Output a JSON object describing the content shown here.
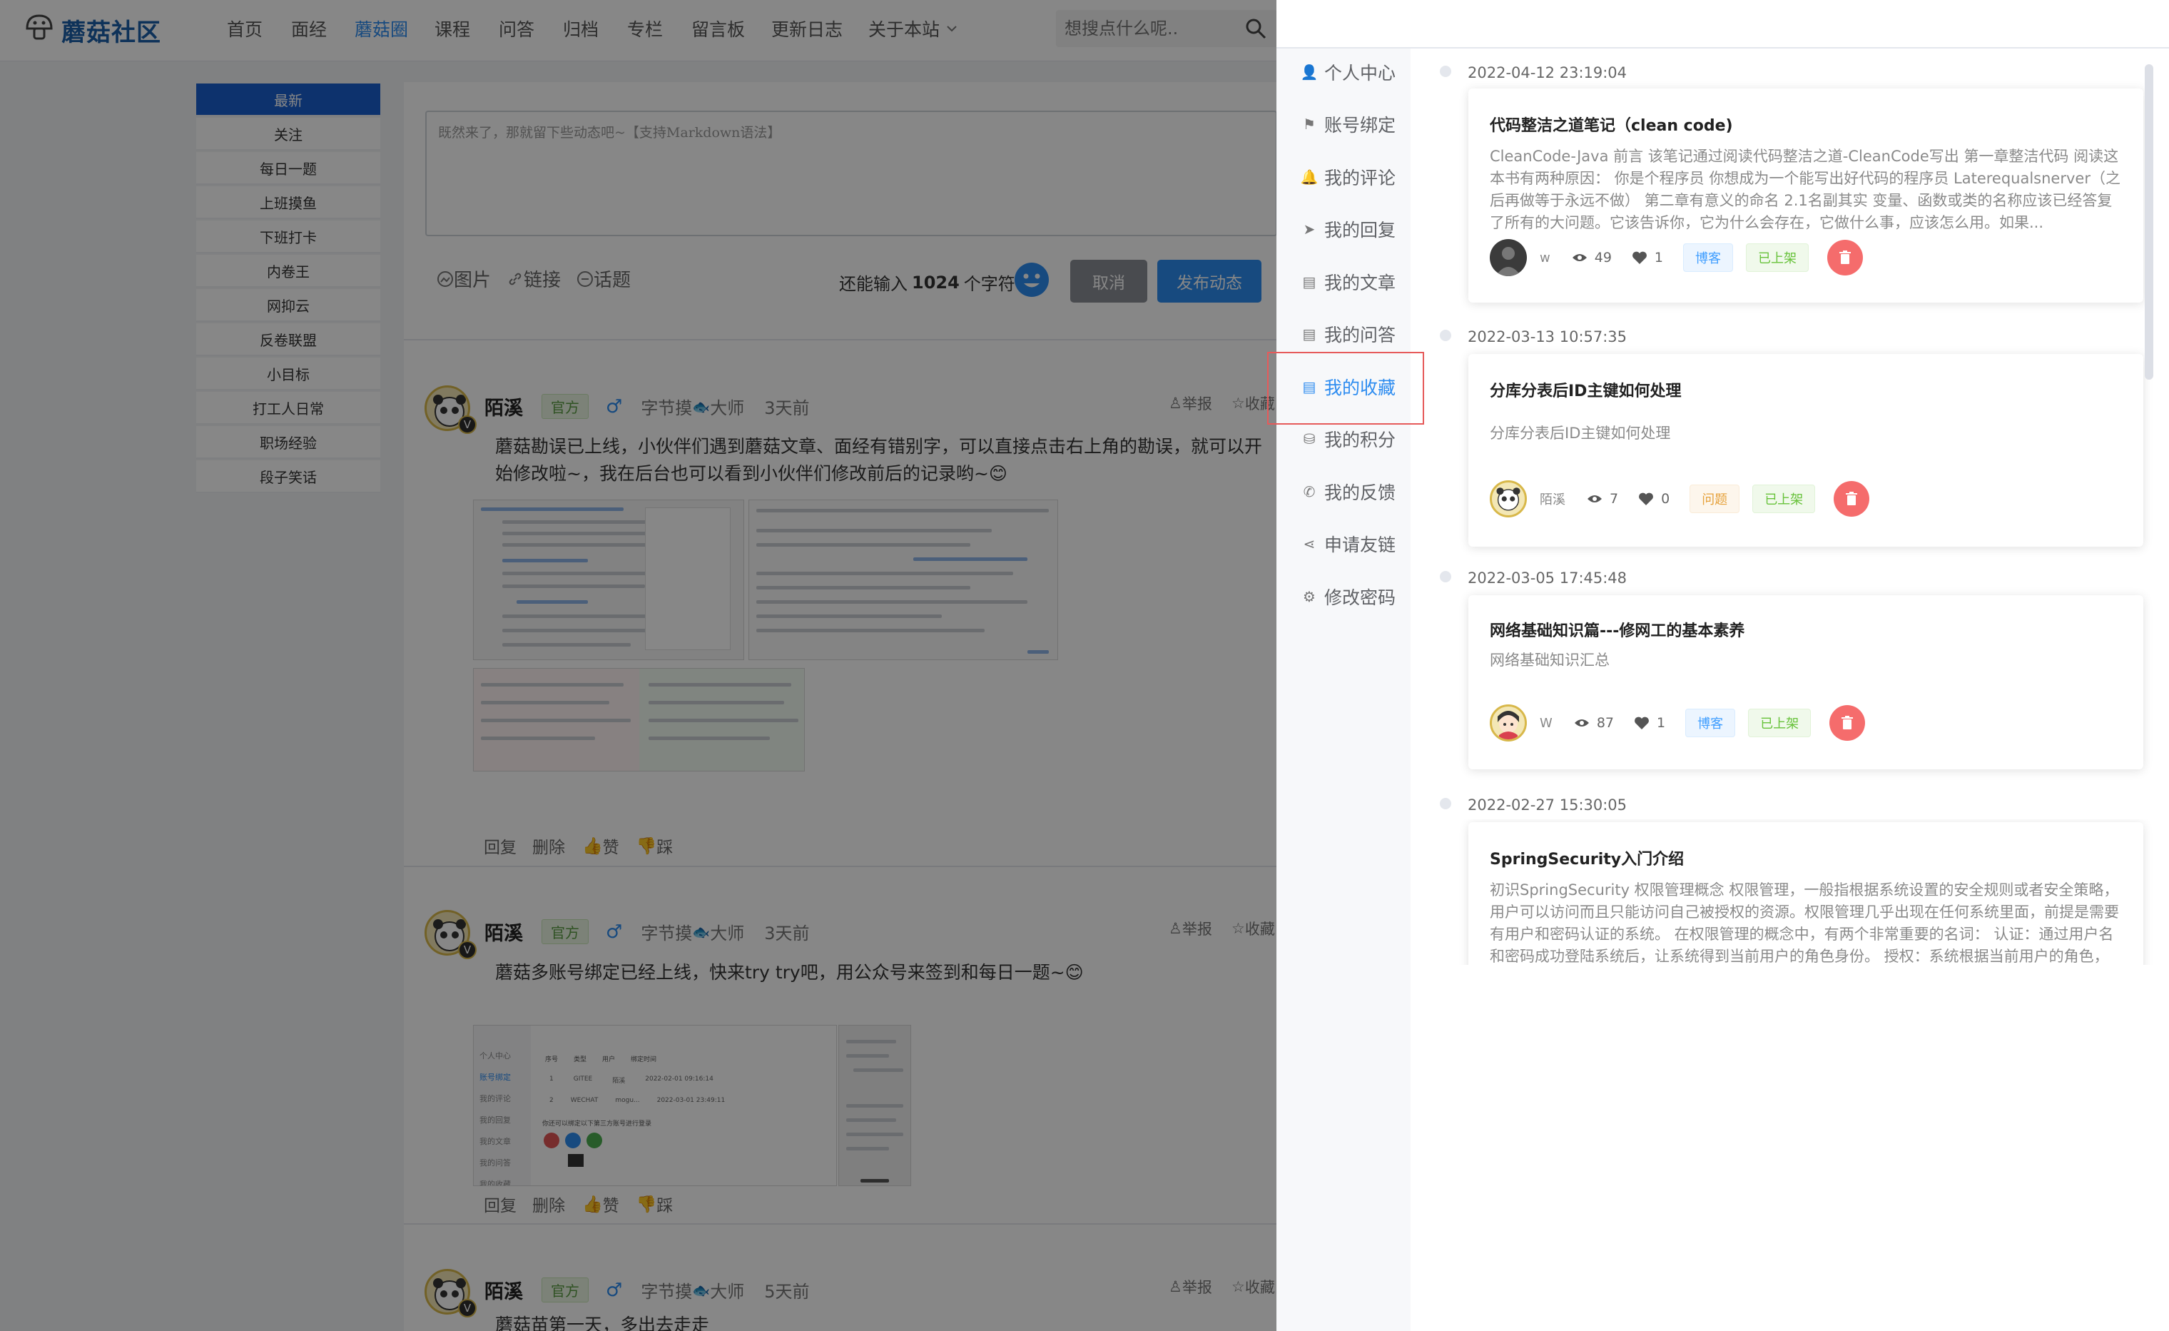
{
  "header": {
    "logo": "蘑菇社区",
    "nav": [
      "首页",
      "面经",
      "蘑菇圈",
      "课程",
      "问答",
      "归档",
      "专栏",
      "留言板",
      "更新日志",
      "关于本站"
    ],
    "nav_active": "蘑菇圈",
    "search_placeholder": "想搜点什么呢.."
  },
  "categories": [
    "最新",
    "关注",
    "每日一题",
    "上班摸鱼",
    "下班打卡",
    "内卷王",
    "网抑云",
    "反卷联盟",
    "小目标",
    "打工人日常",
    "职场经验",
    "段子笑话"
  ],
  "editor": {
    "placeholder": "既然来了，那就留下些动态吧~【支持Markdown语法】",
    "tools": [
      "图片",
      "链接",
      "话题"
    ],
    "remain_prefix": "还能输入",
    "remain_count": "1024",
    "remain_suffix": "个字符",
    "cancel": "取消",
    "publish": "发布动态"
  },
  "posts": [
    {
      "user": "陌溪",
      "official": "官方",
      "level": "字节摸",
      "level2": "大师",
      "time": "3天前",
      "report": "举报",
      "fav": "收藏",
      "text": "蘑菇勘误已上线，小伙伴们遇到蘑菇文章、面经有错别字，可以直接点击右上角的勘误，就可以开始修改啦~，我在后台也可以看到小伙伴们修改前后的记录哟~😊"
    },
    {
      "user": "陌溪",
      "official": "官方",
      "level": "字节摸",
      "level2": "大师",
      "time": "3天前",
      "report": "举报",
      "fav": "收藏",
      "text": "蘑菇多账号绑定已经上线，快来try try吧，用公众号来签到和每日一题~😊"
    },
    {
      "user": "陌溪",
      "official": "官方",
      "level": "字节摸",
      "level2": "大师",
      "time": "5天前",
      "report": "举报",
      "fav": "收藏",
      "text": "蘑菇苗第一天，多出去走走"
    }
  ],
  "post_actions": {
    "reply": "回复",
    "delete": "删除",
    "like": "赞",
    "dislike": "踩"
  },
  "shot2": {
    "menu": [
      "个人中心",
      "账号绑定",
      "我的评论",
      "我的回复",
      "我的文章",
      "我的问答",
      "我的收藏"
    ],
    "cols": [
      "序号",
      "类型",
      "用户",
      "绑定时间"
    ],
    "rows": [
      [
        "1",
        "GITEE",
        "陌溪",
        "2022-02-01 09:16:14"
      ],
      [
        "2",
        "WECHAT",
        "mogu...",
        "2022-03-01 23:49:11"
      ]
    ],
    "hint": "你还可以绑定以下第三方账号进行登录"
  },
  "drawer": {
    "menu": [
      {
        "label": "个人中心",
        "icon": "user-icon",
        "glyph": "👤"
      },
      {
        "label": "账号绑定",
        "icon": "flag-icon",
        "glyph": "⚑"
      },
      {
        "label": "我的评论",
        "icon": "bell-icon",
        "glyph": "🔔"
      },
      {
        "label": "我的回复",
        "icon": "send-icon",
        "glyph": "➤"
      },
      {
        "label": "我的文章",
        "icon": "document-icon",
        "glyph": "▤"
      },
      {
        "label": "我的问答",
        "icon": "clipboard-icon",
        "glyph": "▤"
      },
      {
        "label": "我的收藏",
        "icon": "bookmark-icon",
        "glyph": "▤"
      },
      {
        "label": "我的积分",
        "icon": "database-icon",
        "glyph": "⛁"
      },
      {
        "label": "我的反馈",
        "icon": "phone-icon",
        "glyph": "✆"
      },
      {
        "label": "申请友链",
        "icon": "share-icon",
        "glyph": "⋖"
      },
      {
        "label": "修改密码",
        "icon": "gear-icon",
        "glyph": "⚙"
      }
    ],
    "active": "我的收藏",
    "items": [
      {
        "date": "2022-04-12 23:19:04",
        "title": "代码整洁之道笔记（clean code)",
        "desc": "CleanCode-Java 前言 该笔记通过阅读代码整洁之道-CleanCode写出 第一章整洁代码 阅读这本书有两种原因： 你是个程序员 你想成为一个能写出好代码的程序员 Laterequalsnerver（之后再做等于永远不做） 第二章有意义的命名 2.1名副其实 变量、函数或类的名称应该已经答复了所有的大问题。它该告诉你，它为什么会存在，它做什么事，应该怎么用。如果...",
        "author": "w",
        "views": "49",
        "likes": "1",
        "type": "博客",
        "status": "已上架"
      },
      {
        "date": "2022-03-13 10:57:35",
        "title": "分库分表后ID主键如何处理",
        "desc": "分库分表后ID主键如何处理",
        "author": "陌溪",
        "views": "7",
        "likes": "0",
        "type": "问题",
        "status": "已上架"
      },
      {
        "date": "2022-03-05 17:45:48",
        "title": "网络基础知识篇---修网工的基本素养",
        "desc": "网络基础知识汇总",
        "author": "W",
        "views": "87",
        "likes": "1",
        "type": "博客",
        "status": "已上架"
      },
      {
        "date": "2022-02-27 15:30:05",
        "title": "SpringSecurity入门介绍",
        "desc": "初识SpringSecurity 权限管理概念 权限管理，一般指根据系统设置的安全规则或者安全策略，用户可以访问而且只能访问自己被授权的资源。权限管理几乎出现在任何系统里面，前提是需要有用户和密码认证的系统。 在权限管理的概念中，有两个非常重要的名词： 认证：通过用户名和密码成功登陆系统后，让系统得到当前用户的角色身份。 授权：系统根据当前用户的角色，",
        "author": "",
        "views": "",
        "likes": "",
        "type": "",
        "status": ""
      }
    ]
  },
  "colors": {
    "primary": "#1a5fce",
    "accent": "#2d8cf0",
    "danger": "#f56c6c"
  }
}
